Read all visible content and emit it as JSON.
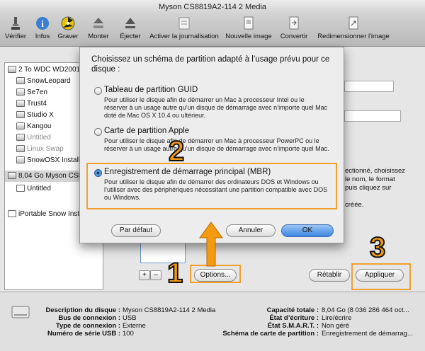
{
  "window": {
    "title": "Myson CS8819A2-114 2 Media"
  },
  "toolbar": [
    {
      "label": "Vérifier",
      "icon": "microscope-icon"
    },
    {
      "label": "Infos",
      "icon": "info-icon"
    },
    {
      "label": "Graver",
      "icon": "burn-icon"
    },
    {
      "label": "Monter",
      "icon": "mount-icon"
    },
    {
      "label": "Éjecter",
      "icon": "eject-icon"
    },
    {
      "label": "Activer la journalisation",
      "icon": "journal-icon"
    },
    {
      "label": "Nouvelle image",
      "icon": "new-image-icon"
    },
    {
      "label": "Convertir",
      "icon": "convert-icon"
    },
    {
      "label": "Redimensionner l'image",
      "icon": "resize-image-icon"
    }
  ],
  "sidebar": [
    {
      "label": "2 To WDC WD2001",
      "grey": false,
      "selected": false
    },
    {
      "label": "SnowLeopard",
      "grey": false,
      "selected": false
    },
    {
      "label": "Se7en",
      "grey": false,
      "selected": false
    },
    {
      "label": "Trust4",
      "grey": false,
      "selected": false
    },
    {
      "label": "Studio X",
      "grey": false,
      "selected": false
    },
    {
      "label": "Kangou",
      "grey": false,
      "selected": false
    },
    {
      "label": "Untitled",
      "grey": true,
      "selected": false
    },
    {
      "label": "Linux Swap",
      "grey": true,
      "selected": false
    },
    {
      "label": "SnowOSX Install",
      "grey": false,
      "selected": false
    },
    {
      "label": "8,04 Go Myson CS8",
      "grey": false,
      "selected": true
    },
    {
      "label": "Untitled",
      "grey": false,
      "selected": false
    },
    {
      "label": "iPortable Snow Inst",
      "grey": false,
      "selected": false
    }
  ],
  "background": {
    "right_text": [
      "ectionné, choisissez",
      "le nom, le format",
      "puis cliquez sur",
      "créée."
    ],
    "options_button": "Options...",
    "revert_button": "Rétablir",
    "apply_button": "Appliquer",
    "plus": "+",
    "minus": "–"
  },
  "sheet": {
    "prompt": "Choisissez un schéma de partition adapté à l’usage prévu pour ce disque :",
    "options": [
      {
        "label": "Tableau de partition GUID",
        "desc": "Pour utiliser le disque afin de démarrer un Mac à processeur Intel ou le réserver à un usage autre qu’un disque de démarrage avec n’importe quel Mac doté de Mac OS X 10.4 ou ultérieur.",
        "selected": false
      },
      {
        "label": "Carte de partition Apple",
        "desc": "Pour utiliser le disque afin de démarrer un Mac à processeur PowerPC ou le réserver à un usage autre qu’un disque de démarrage avec n’importe quel Mac.",
        "selected": false
      },
      {
        "label": "Enregistrement de démarrage principal (MBR)",
        "desc": "Pour utiliser le disque afin de démarrer des ordinateurs DOS et Windows ou l’utiliser avec des périphériques nécessitant une partition compatible avec DOS ou Windows.",
        "selected": true
      }
    ],
    "default_button": "Par défaut",
    "cancel_button": "Annuler",
    "ok_button": "OK"
  },
  "annotations": {
    "one": "1",
    "two": "2",
    "three": "3",
    "accent": "#f39a12"
  },
  "info": {
    "left": [
      {
        "key": "Description du disque :",
        "value": "Myson CS8819A2-114 2 Media"
      },
      {
        "key": "Bus de connexion :",
        "value": "USB"
      },
      {
        "key": "Type de connexion :",
        "value": "Externe"
      },
      {
        "key": "Numéro de série USB :",
        "value": "100"
      }
    ],
    "right": [
      {
        "key": "Capacité totale :",
        "value": "8,04 Go (8 036 286 464 oct..."
      },
      {
        "key": "État d’écriture :",
        "value": "Lire/écrire"
      },
      {
        "key": "État S.M.A.R.T. :",
        "value": "Non géré"
      },
      {
        "key": "Schéma de carte de partition :",
        "value": "Enregistrement de démarrag..."
      }
    ]
  }
}
